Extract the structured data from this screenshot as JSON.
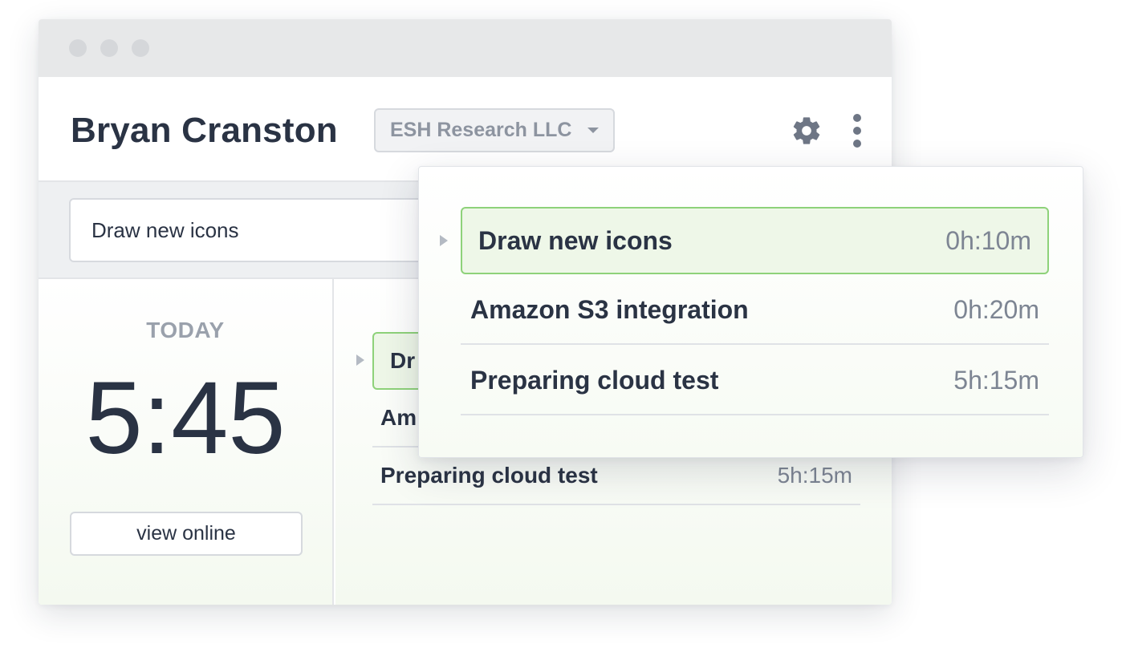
{
  "header": {
    "user_name": "Bryan Cranston",
    "company": "ESH Research LLC"
  },
  "search": {
    "value": "Draw new icons"
  },
  "today": {
    "label": "TODAY",
    "time": "5:45",
    "view_online_label": "view online"
  },
  "background_tasks": [
    {
      "name": "Dr",
      "time": ""
    },
    {
      "name": "Am",
      "time": ""
    },
    {
      "name": "Preparing cloud test",
      "time": "5h:15m"
    }
  ],
  "popup_tasks": [
    {
      "name": "Draw new icons",
      "time": "0h:10m",
      "active": true
    },
    {
      "name": "Amazon S3 integration",
      "time": "0h:20m",
      "active": false
    },
    {
      "name": "Preparing cloud test",
      "time": "5h:15m",
      "active": false
    }
  ],
  "colors": {
    "accent_green": "#8ed27a",
    "active_bg": "#eef7e8",
    "text_dark": "#2a3344",
    "text_muted": "#7d8593"
  }
}
